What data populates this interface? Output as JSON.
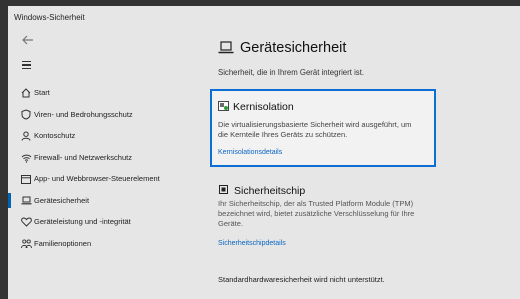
{
  "window": {
    "title": "Windows-Sicherheit"
  },
  "nav": {
    "back_icon": "back-arrow-icon",
    "menu_icon": "hamburger-icon",
    "items": [
      {
        "label": "Start",
        "icon": "home-icon",
        "active": false
      },
      {
        "label": "Viren- und Bedrohungsschutz",
        "icon": "shield-icon",
        "active": false
      },
      {
        "label": "Kontoschutz",
        "icon": "person-icon",
        "active": false
      },
      {
        "label": "Firewall- und Netzwerkschutz",
        "icon": "wifi-icon",
        "active": false
      },
      {
        "label": "App- und Webbrowser-Steuerelement",
        "icon": "browser-icon",
        "active": false
      },
      {
        "label": "Gerätesicherheit",
        "icon": "laptop-icon",
        "active": true
      },
      {
        "label": "Geräteleistung und -integrität",
        "icon": "heart-icon",
        "active": false
      },
      {
        "label": "Familienoptionen",
        "icon": "family-icon",
        "active": false
      }
    ]
  },
  "main": {
    "title": "Gerätesicherheit",
    "subtitle": "Sicherheit, die in Ihrem Gerät integriert ist.",
    "core_isolation": {
      "title": "Kernisolation",
      "description": "Die virtualisierungsbasierte Sicherheit wird ausgeführt, um die Kernteile Ihres Geräts zu schützen.",
      "link": "Kernisolationsdetails"
    },
    "security_chip": {
      "title": "Sicherheitschip",
      "description": "Ihr Sicherheitschip, der als Trusted Platform Module (TPM) bezeichnet wird, bietet zusätzliche Verschlüsselung für Ihre Geräte.",
      "link": "Sicherheitschipdetails"
    },
    "footer": "Standardhardwaresicherheit wird nicht unterstützt."
  },
  "colors": {
    "accent": "#0b6fd6",
    "link": "#0a66c2",
    "background": "#e6e6e6"
  }
}
